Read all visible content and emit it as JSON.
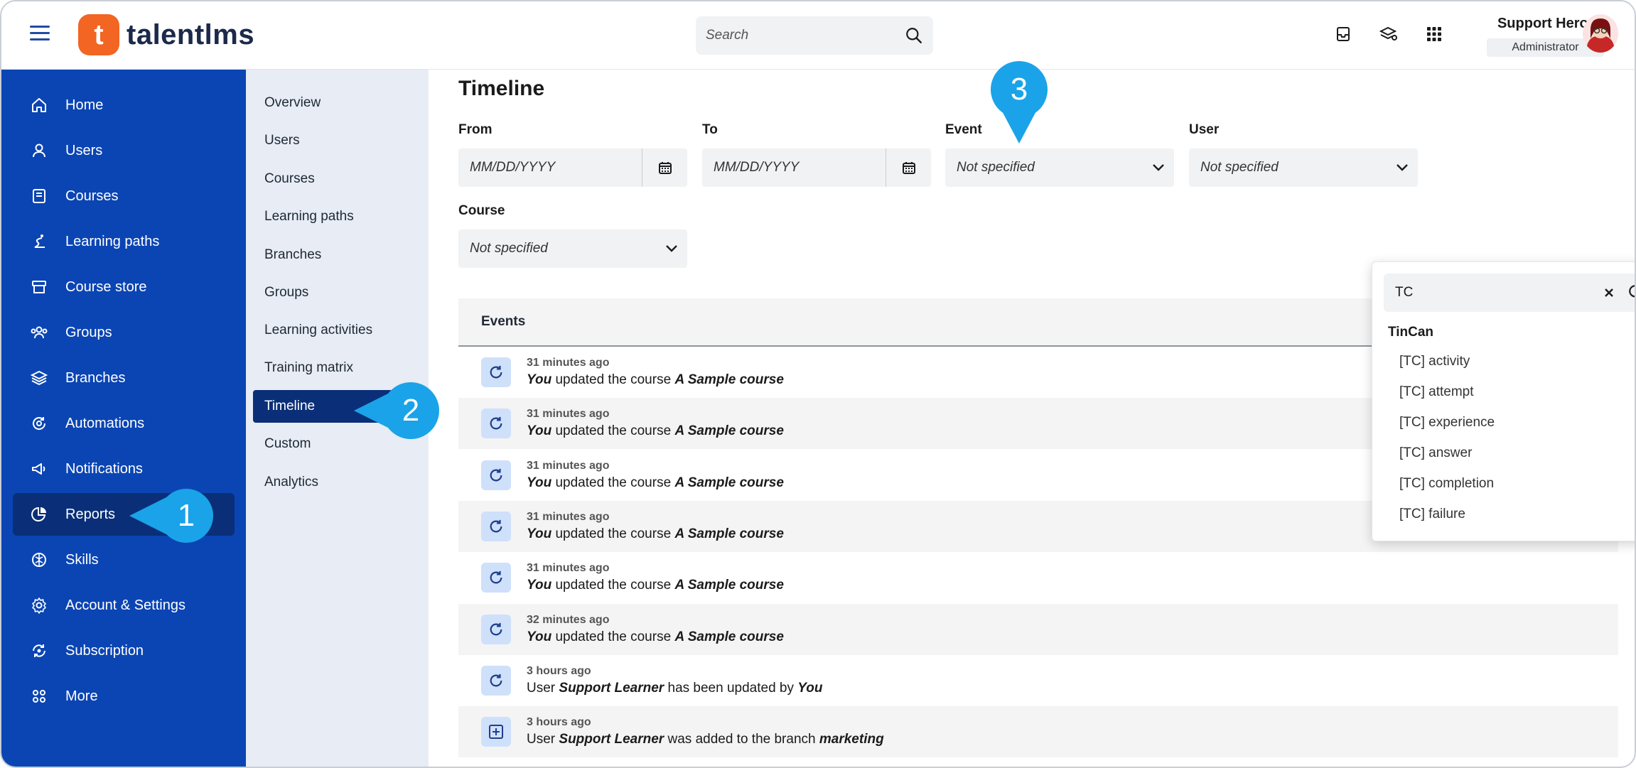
{
  "header": {
    "logo_letter": "t",
    "logo_text": "talentlms",
    "search_placeholder": "Search",
    "user_name": "Support Heroes",
    "user_role": "Administrator"
  },
  "sidebar": {
    "items": [
      {
        "label": "Home",
        "icon": "home-icon"
      },
      {
        "label": "Users",
        "icon": "user-icon"
      },
      {
        "label": "Courses",
        "icon": "book-icon"
      },
      {
        "label": "Learning paths",
        "icon": "path-icon"
      },
      {
        "label": "Course store",
        "icon": "store-icon"
      },
      {
        "label": "Groups",
        "icon": "groups-icon"
      },
      {
        "label": "Branches",
        "icon": "layers-icon"
      },
      {
        "label": "Automations",
        "icon": "automation-icon"
      },
      {
        "label": "Notifications",
        "icon": "megaphone-icon"
      },
      {
        "label": "Reports",
        "icon": "pie-chart-icon",
        "active": true
      },
      {
        "label": "Skills",
        "icon": "brain-icon"
      },
      {
        "label": "Account & Settings",
        "icon": "gear-icon"
      },
      {
        "label": "Subscription",
        "icon": "subscription-icon"
      },
      {
        "label": "More",
        "icon": "more-icon"
      }
    ]
  },
  "subnav": {
    "items": [
      {
        "label": "Overview"
      },
      {
        "label": "Users"
      },
      {
        "label": "Courses"
      },
      {
        "label": "Learning paths"
      },
      {
        "label": "Branches"
      },
      {
        "label": "Groups"
      },
      {
        "label": "Learning activities"
      },
      {
        "label": "Training matrix"
      },
      {
        "label": "Timeline",
        "active": true
      },
      {
        "label": "Custom"
      },
      {
        "label": "Analytics"
      }
    ]
  },
  "callouts": [
    "1",
    "2",
    "3"
  ],
  "main": {
    "title": "Timeline",
    "filters": {
      "from_label": "From",
      "from_placeholder": "MM/DD/YYYY",
      "to_label": "To",
      "to_placeholder": "MM/DD/YYYY",
      "event_label": "Event",
      "event_value": "Not specified",
      "user_label": "User",
      "user_value": "Not specified",
      "course_label": "Course",
      "course_value": "Not specified"
    },
    "events_header": "Events",
    "events": [
      {
        "time": "31 minutes ago",
        "parts": [
          "You",
          " updated the course ",
          "A Sample course"
        ],
        "icon": "refresh-icon"
      },
      {
        "time": "31 minutes ago",
        "parts": [
          "You",
          " updated the course ",
          "A Sample course"
        ],
        "icon": "refresh-icon"
      },
      {
        "time": "31 minutes ago",
        "parts": [
          "You",
          " updated the course ",
          "A Sample course"
        ],
        "icon": "refresh-icon"
      },
      {
        "time": "31 minutes ago",
        "parts": [
          "You",
          " updated the course ",
          "A Sample course"
        ],
        "icon": "refresh-icon"
      },
      {
        "time": "31 minutes ago",
        "parts": [
          "You",
          " updated the course ",
          "A Sample course"
        ],
        "icon": "refresh-icon"
      },
      {
        "time": "32 minutes ago",
        "parts": [
          "You",
          " updated the course ",
          "A Sample course"
        ],
        "icon": "refresh-icon"
      },
      {
        "time": "3 hours ago",
        "parts": [
          "User ",
          "Support Learner",
          " has been updated by ",
          "You"
        ],
        "icon": "refresh-icon"
      },
      {
        "time": "3 hours ago",
        "parts": [
          "User ",
          "Support Learner",
          " was added to the branch ",
          "marketing"
        ],
        "icon": "plus-square-icon"
      }
    ]
  },
  "event_dropdown": {
    "search_value": "TC",
    "group": "TinCan",
    "options": [
      "[TC] activity",
      "[TC] attempt",
      "[TC] experience",
      "[TC] answer",
      "[TC] completion",
      "[TC] failure"
    ]
  },
  "colors": {
    "sidebar_bg": "#0b45b3",
    "active_bg": "#0a2f78",
    "subnav_bg": "#e7ecf5",
    "brand_orange": "#f26522",
    "callout": "#1aa3e8"
  }
}
